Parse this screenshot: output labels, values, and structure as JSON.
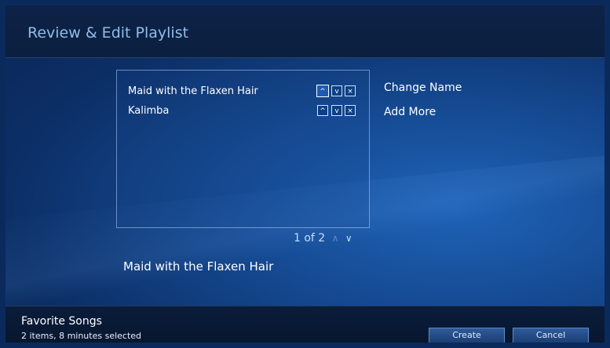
{
  "header": {
    "title": "Review & Edit Playlist"
  },
  "playlist_items": [
    {
      "name": "Maid with the Flaxen Hair",
      "controls": {
        "move_up": "^",
        "move_down": "v",
        "remove": "×"
      }
    },
    {
      "name": "Kalimba",
      "controls": {
        "move_up": "^",
        "move_down": "v",
        "remove": "×"
      }
    }
  ],
  "side_actions": {
    "change_name": "Change Name",
    "add_more": "Add More"
  },
  "pager": {
    "text": "1 of 2",
    "up_icon": "∧",
    "down_icon": "∨"
  },
  "selected_item_title": "Maid with the Flaxen Hair",
  "footer": {
    "playlist_name": "Favorite Songs",
    "playlist_info": "2 items, 8 minutes selected",
    "create_label": "Create",
    "cancel_label": "Cancel"
  }
}
